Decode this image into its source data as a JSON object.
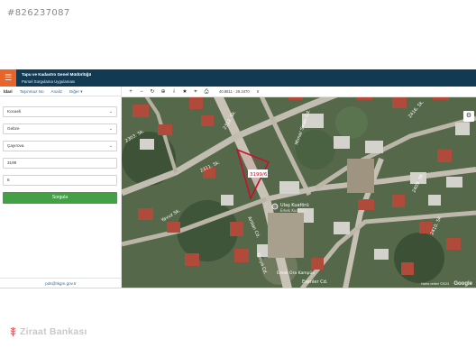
{
  "listing_id": "#826237087",
  "header": {
    "title": "Tapu ve Kadastro Genel Müdürlüğü",
    "subtitle": "Parsel Sorgulama Uygulaması"
  },
  "tabs": [
    {
      "label": "İdari",
      "active": true
    },
    {
      "label": "Taşınmaz No",
      "active": false
    },
    {
      "label": "Analiz",
      "active": false
    },
    {
      "label": "Diğer ▾",
      "active": false
    }
  ],
  "form": {
    "il": "Kocaeli",
    "ilce": "Gebze",
    "mahalle": "Çayırova",
    "ada": "3199",
    "parsel": "6",
    "submit_label": "Sorgula"
  },
  "contact_email": "pds@tkgm.gov.tr",
  "toolbar": {
    "coordinates": "40.8811 - 29.3470",
    "zoom_label": "tr"
  },
  "map": {
    "parcel_label": "3199/6",
    "streets": [
      "2303. Sk.",
      "2311. Sk.",
      "2312. Sk.",
      "Mimar Sinan Cd.",
      "Arslan Cd.",
      "Konya Cd.",
      "Esenler Cd.",
      "2409. Sk.",
      "2410. Sk.",
      "2416. Sk.",
      "Yavuz Sk."
    ],
    "poi": "Ulaş Kuaförü",
    "poi_sub": "Erkek Kuaförü",
    "school": "Emek Ora Kampüs",
    "attribution": "Harita verileri ©2023",
    "provider": "Google"
  },
  "bank_name": "Ziraat Bankası",
  "colors": {
    "topbar": "#123a52",
    "menu": "#e8642a",
    "submit": "#43a047",
    "parcel": "#c0142a",
    "bank": "#c9c9c9"
  }
}
